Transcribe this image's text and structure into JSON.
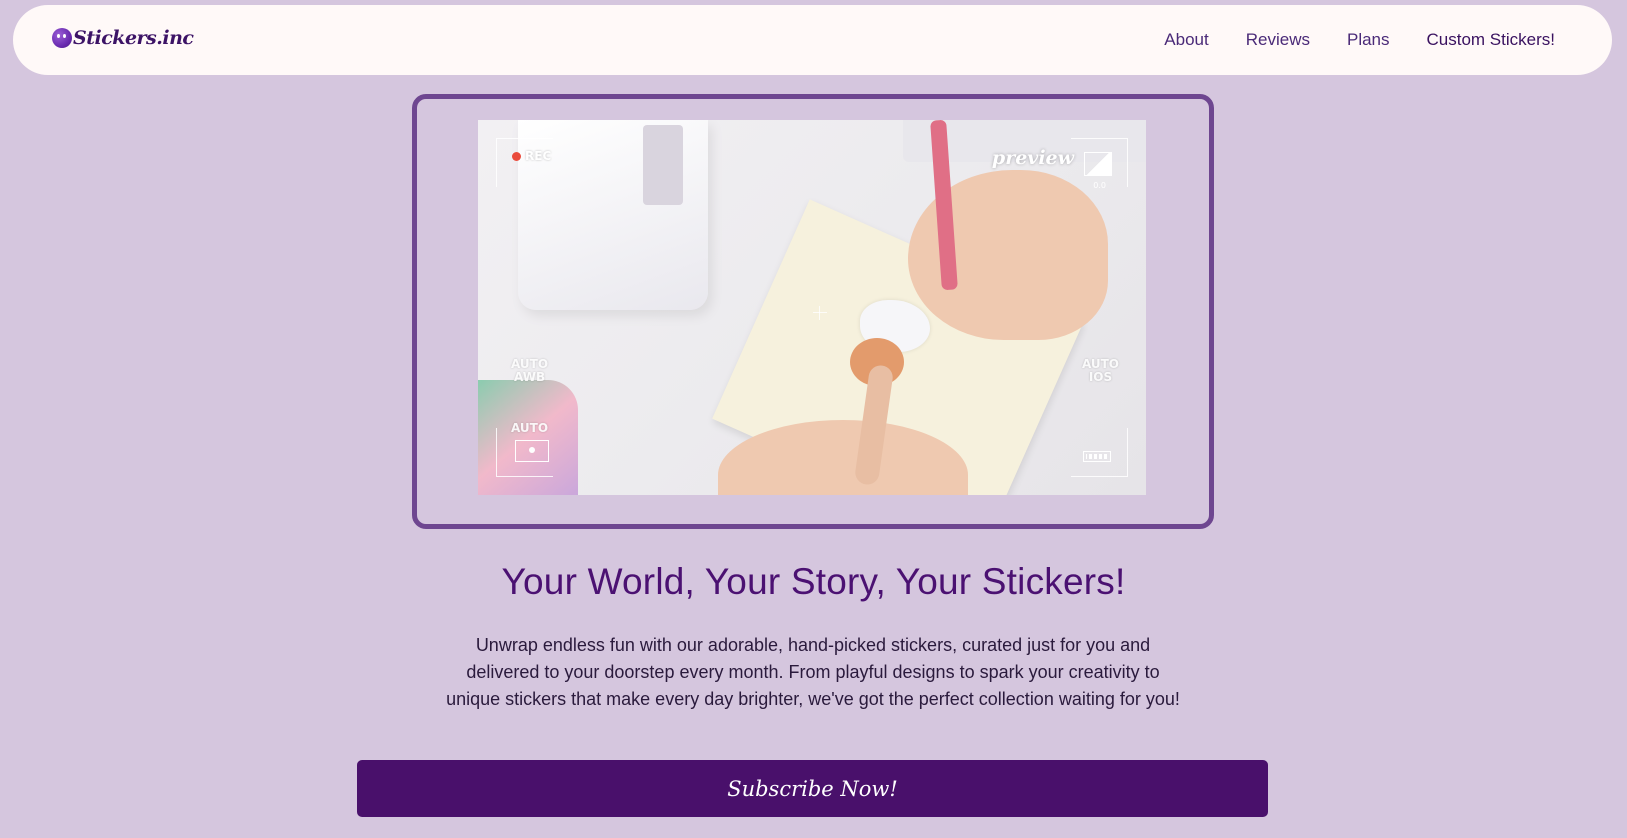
{
  "nav": {
    "brand": "Stickers.inc",
    "links": [
      {
        "label": "About"
      },
      {
        "label": "Reviews"
      },
      {
        "label": "Plans"
      },
      {
        "label": "Custom Stickers!"
      }
    ]
  },
  "video": {
    "rec_label": "REC",
    "preview_label": "preview",
    "exposure_value": "0.0",
    "awb_label": "AUTO\nAWB",
    "ios_label": "AUTO\nIOS",
    "focus_label": "AUTO"
  },
  "hero": {
    "title": "Your World, Your Story, Your Stickers!",
    "description": "Unwrap endless fun with our adorable, hand-picked stickers, curated just for you and delivered to your doorstep every month. From playful designs to spark your creativity to unique stickers that make every day brighter, we've got the perfect collection waiting for you!",
    "cta_label": "Subscribe Now!"
  },
  "colors": {
    "page_background": "#d5c6de",
    "navbar_background": "#fff9f8",
    "frame_border": "#6e4690",
    "title_color": "#4b1172",
    "button_background": "#49106b"
  }
}
